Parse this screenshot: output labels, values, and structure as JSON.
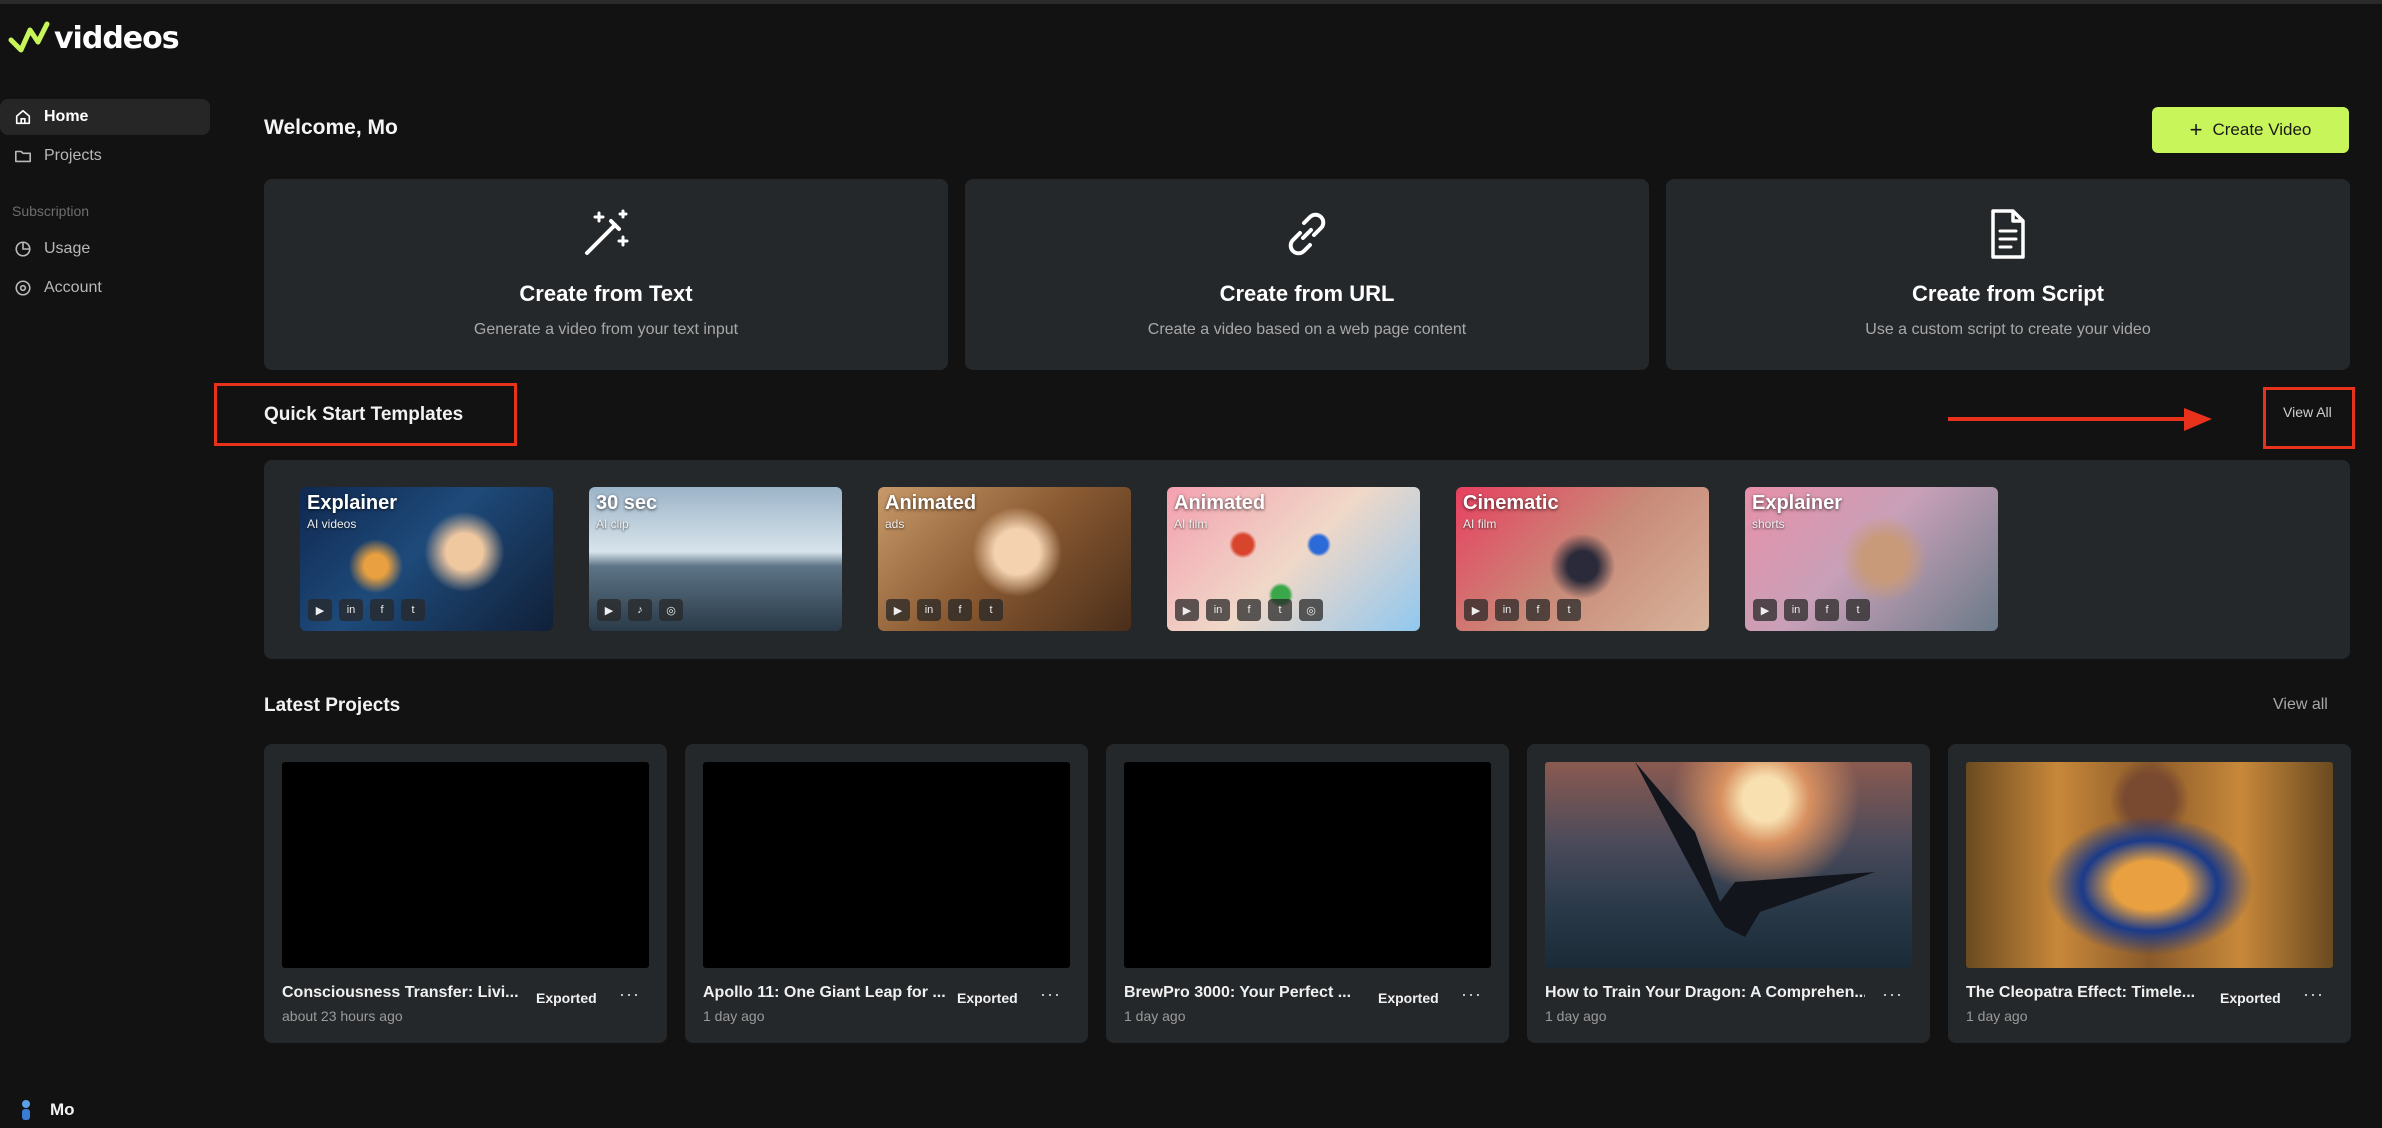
{
  "app": {
    "name": "viddeos"
  },
  "sidebar": {
    "items": [
      {
        "label": "Home",
        "icon": "home-icon"
      },
      {
        "label": "Projects",
        "icon": "folder-icon"
      }
    ],
    "section_label": "Subscription",
    "sub_items": [
      {
        "label": "Usage",
        "icon": "pie-chart-icon"
      },
      {
        "label": "Account",
        "icon": "gear-icon"
      }
    ],
    "user": {
      "name": "Mo"
    }
  },
  "header": {
    "welcome": "Welcome, Mo",
    "create_button": "Create Video"
  },
  "create_cards": [
    {
      "title": "Create from Text",
      "subtitle": "Generate a video from your text input",
      "icon": "magic-wand-icon"
    },
    {
      "title": "Create from URL",
      "subtitle": "Create a video based on a web page content",
      "icon": "link-icon"
    },
    {
      "title": "Create from Script",
      "subtitle": "Use a custom script to create your video",
      "icon": "document-icon"
    }
  ],
  "quick_start": {
    "title": "Quick Start Templates",
    "view_all": "View All",
    "templates": [
      {
        "title": "Explainer",
        "subtitle": "AI videos",
        "badges": [
          "yt",
          "in",
          "f",
          "tw"
        ]
      },
      {
        "title": "30 sec",
        "subtitle": "AI clip",
        "badges": [
          "yt",
          "tk",
          "ig"
        ]
      },
      {
        "title": "Animated",
        "subtitle": "ads",
        "badges": [
          "yt",
          "in",
          "f",
          "tw"
        ]
      },
      {
        "title": "Animated",
        "subtitle": "AI film",
        "badges": [
          "yt",
          "in",
          "f",
          "tw",
          "ig"
        ]
      },
      {
        "title": "Cinematic",
        "subtitle": "AI film",
        "badges": [
          "yt",
          "in",
          "f",
          "tw"
        ]
      },
      {
        "title": "Explainer",
        "subtitle": "shorts",
        "badges": [
          "yt",
          "in",
          "f",
          "tw"
        ]
      }
    ]
  },
  "latest_projects": {
    "title": "Latest Projects",
    "view_all": "View all",
    "projects": [
      {
        "title": "Consciousness Transfer: Livi...",
        "time": "about 23 hours ago",
        "status": "Exported"
      },
      {
        "title": "Apollo 11: One Giant Leap for ...",
        "time": "1 day ago",
        "status": "Exported"
      },
      {
        "title": "BrewPro 3000: Your Perfect ...",
        "time": "1 day ago",
        "status": "Exported"
      },
      {
        "title": "How to Train Your Dragon: A Comprehen...",
        "time": "1 day ago",
        "status": ""
      },
      {
        "title": "The Cleopatra Effect: Timele...",
        "time": "1 day ago",
        "status": "Exported"
      }
    ]
  },
  "colors": {
    "accent": "#c8f55a",
    "annotation": "#e8321c",
    "card": "#25282a",
    "background": "#121212"
  }
}
